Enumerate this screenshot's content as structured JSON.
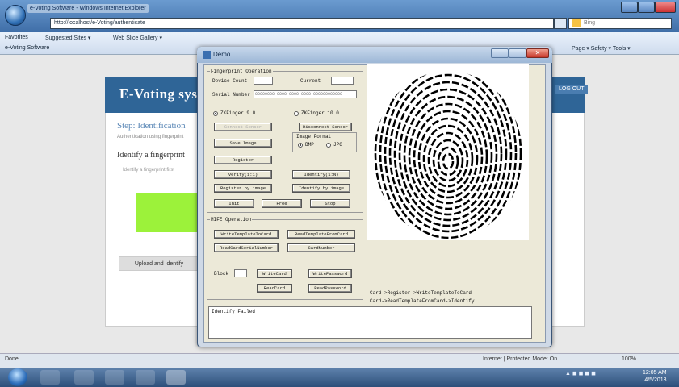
{
  "browser": {
    "tab_title": "e-Voting Software - Windows Internet Explorer",
    "address": "http://localhost/e-Voting/authenticate",
    "search_placeholder": "Bing",
    "favorites_label": "Favorites",
    "fav_item1": "Suggested Sites ▾",
    "fav_item2": "Web Slice Gallery ▾",
    "page_tab": "e-Voting Software",
    "cmd_bar": "Page ▾  Safety ▾  Tools ▾",
    "status_left": "Done",
    "status_zone": "Internet | Protected Mode: On",
    "status_zoom": "100%"
  },
  "site": {
    "title": "E-Voting system",
    "logout": "LOG OUT",
    "step_heading": "Step: Identification",
    "step_sub": "Authentication using fingerprint",
    "identify_heading": "Identify a fingerprint",
    "identify_sub": "Identify a fingerprint first",
    "upload_button": "Upload and Identify"
  },
  "demo": {
    "title": "Demo",
    "close_glyph": "✕",
    "fp_group": "Fingerprint Operation",
    "device_count_label": "Device Count",
    "current_label": "Current",
    "serial_label": "Serial Number",
    "serial_value": "00000000-0000-0000-0000-000000000000",
    "radio_fp_a": "ZKFinger 9.0",
    "radio_fp_b": "ZKFinger 10.0",
    "btn_connect": "Connect Sensor",
    "btn_disconnect": "Disconnect Sensor",
    "btn_save_image": "Save Image",
    "image_format_label": "Image Format",
    "radio_bmp": "BMP",
    "radio_jpg": "JPG",
    "btn_register": "Register",
    "btn_verify": "Verify(1:1)",
    "btn_identify": "Identify(1:N)",
    "btn_register_image": "Register by image",
    "btn_identify_image": "Identify by image",
    "btn_init": "Init",
    "btn_free": "Free",
    "btn_stop": "Stop",
    "mifare_group": "MIFE Operation",
    "btn_write_template": "WriteTemplateToCard",
    "btn_read_template": "ReadTemplateFromCard",
    "btn_read_serial": "ReadCardSerialNumber",
    "btn_card_number": "CardNumber",
    "block_label": "Block",
    "btn_write_card": "WriteCard",
    "btn_write_password": "WritePassword",
    "btn_read_card": "ReadCard",
    "btn_read_password": "ReadPassword",
    "hint1": "Card->Register->WriteTemplateToCard",
    "hint2": "Card->ReadTemplateFromCard->Identify",
    "result_text": "Identify Failed"
  },
  "taskbar": {
    "time": "12:05 AM",
    "date": "4/5/2013"
  },
  "colors": {
    "site_header": "#2f6597",
    "green_box": "#9cf23a"
  }
}
